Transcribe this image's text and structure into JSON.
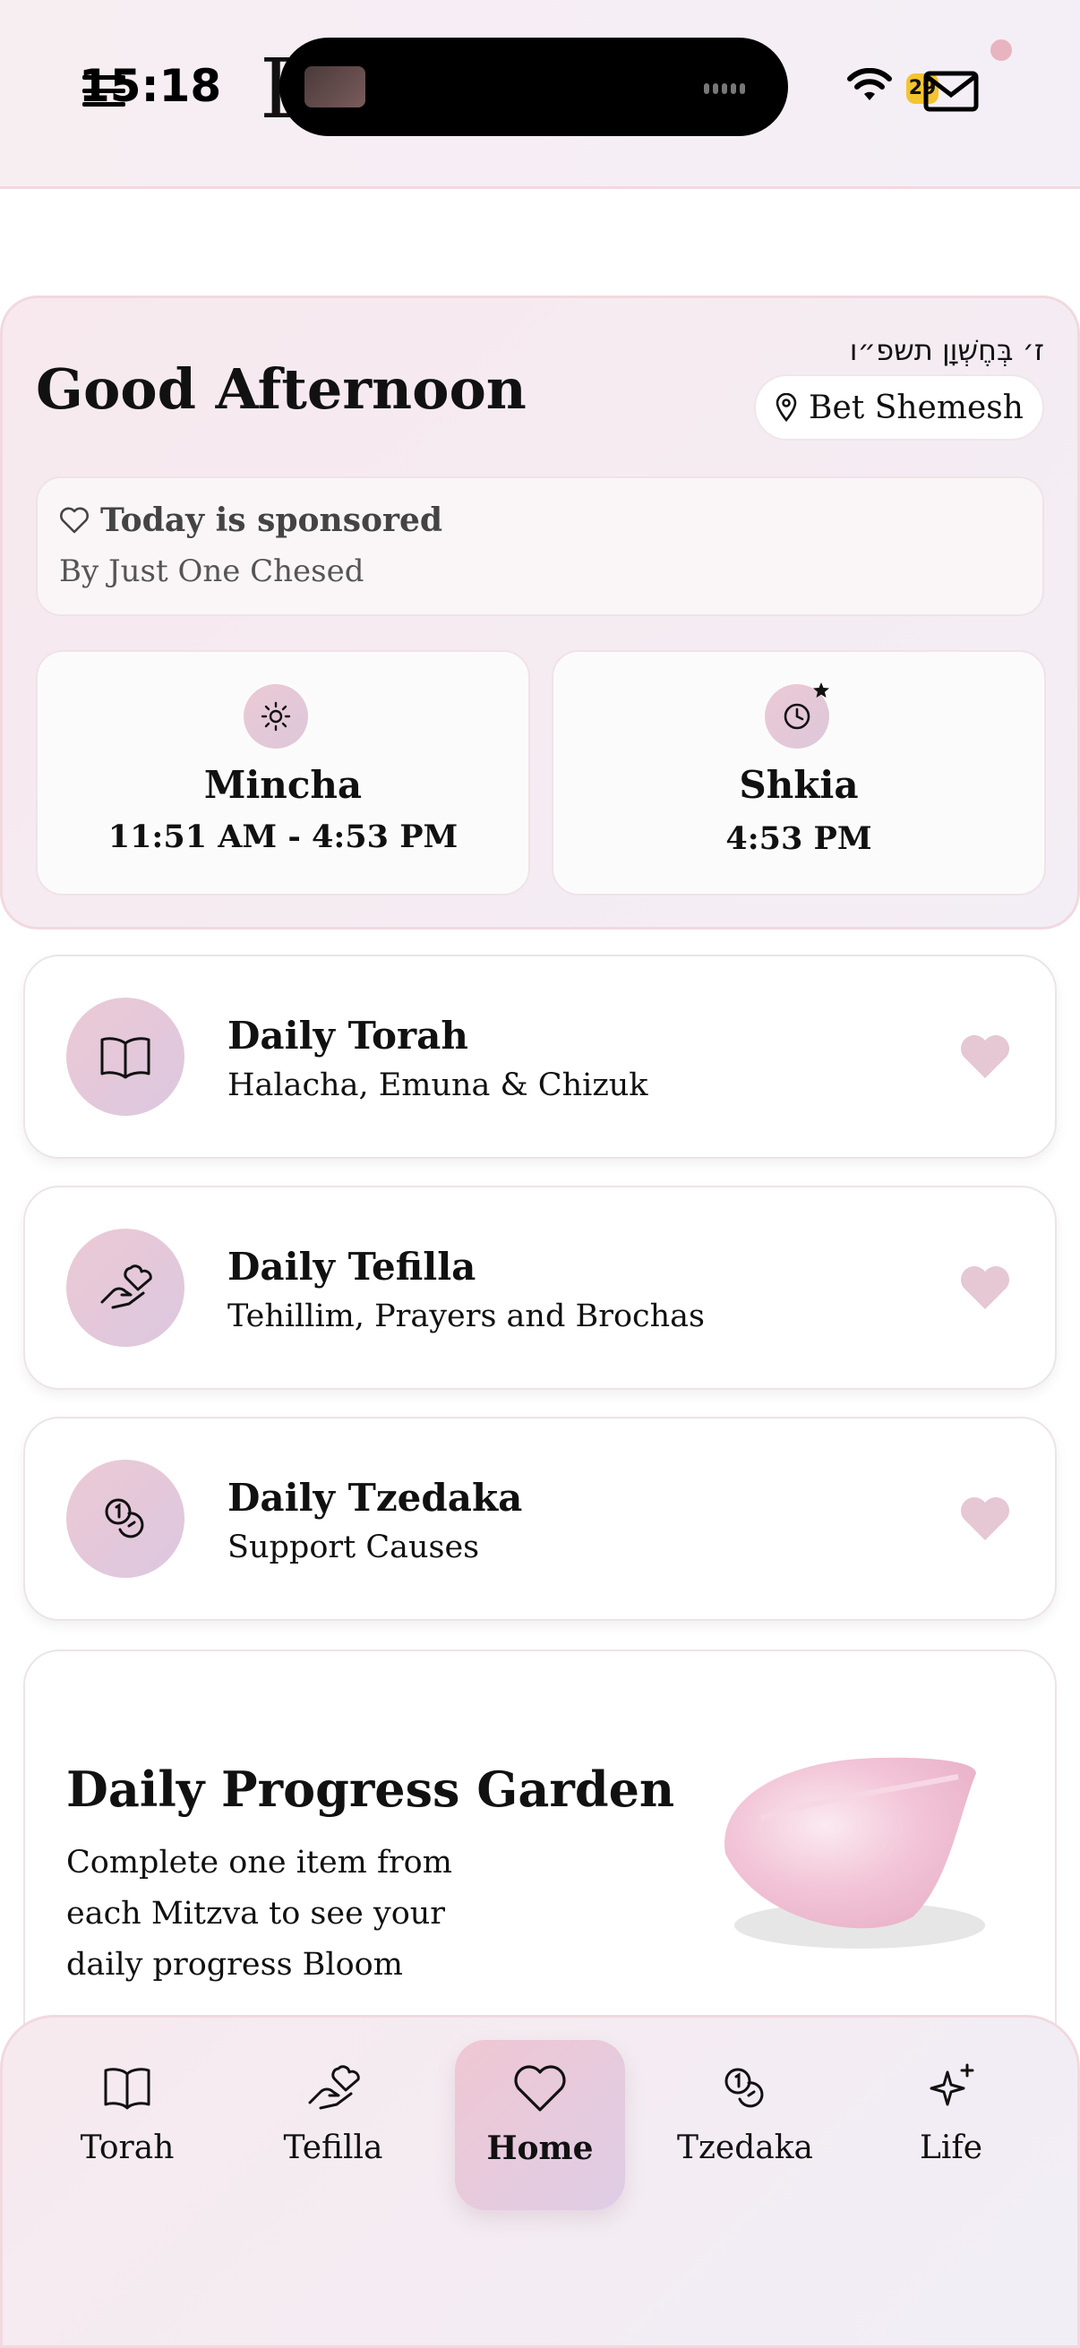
{
  "status_bar": {
    "time": "15:18",
    "battery": "29"
  },
  "header": {
    "brand_left": "B",
    "brand_right": "n"
  },
  "hero": {
    "hebrew_date": "ז׳ בְּחֶשְׁוָן תשפ״ו",
    "greeting": "Good Afternoon",
    "location": "Bet Shemesh",
    "sponsor_title": "Today is sponsored",
    "sponsor_by": "By Just One Chesed",
    "times": [
      {
        "label": "Mincha",
        "value": "11:51 AM - 4:53 PM"
      },
      {
        "label": "Shkia",
        "value": "4:53 PM"
      }
    ]
  },
  "list": [
    {
      "title": "Daily Torah",
      "subtitle": "Halacha, Emuna & Chizuk"
    },
    {
      "title": "Daily Tefilla",
      "subtitle": "Tehillim, Prayers and Brochas"
    },
    {
      "title": "Daily Tzedaka",
      "subtitle": "Support Causes"
    }
  ],
  "garden": {
    "title": "Daily Progress Garden",
    "description": "Complete one item from each Mitzva to see your daily progress Bloom"
  },
  "nav": {
    "items": [
      {
        "label": "Torah",
        "icon": "book-icon"
      },
      {
        "label": "Tefilla",
        "icon": "hand-heart-icon"
      },
      {
        "label": "Home",
        "icon": "heart-icon",
        "active": true
      },
      {
        "label": "Tzedaka",
        "icon": "coins-icon"
      },
      {
        "label": "Life",
        "icon": "sparkles-icon"
      }
    ]
  },
  "colors": {
    "accent_pink": "#e8b4c0",
    "card_border": "#efe3e8",
    "heart": "#e6c7d4"
  }
}
